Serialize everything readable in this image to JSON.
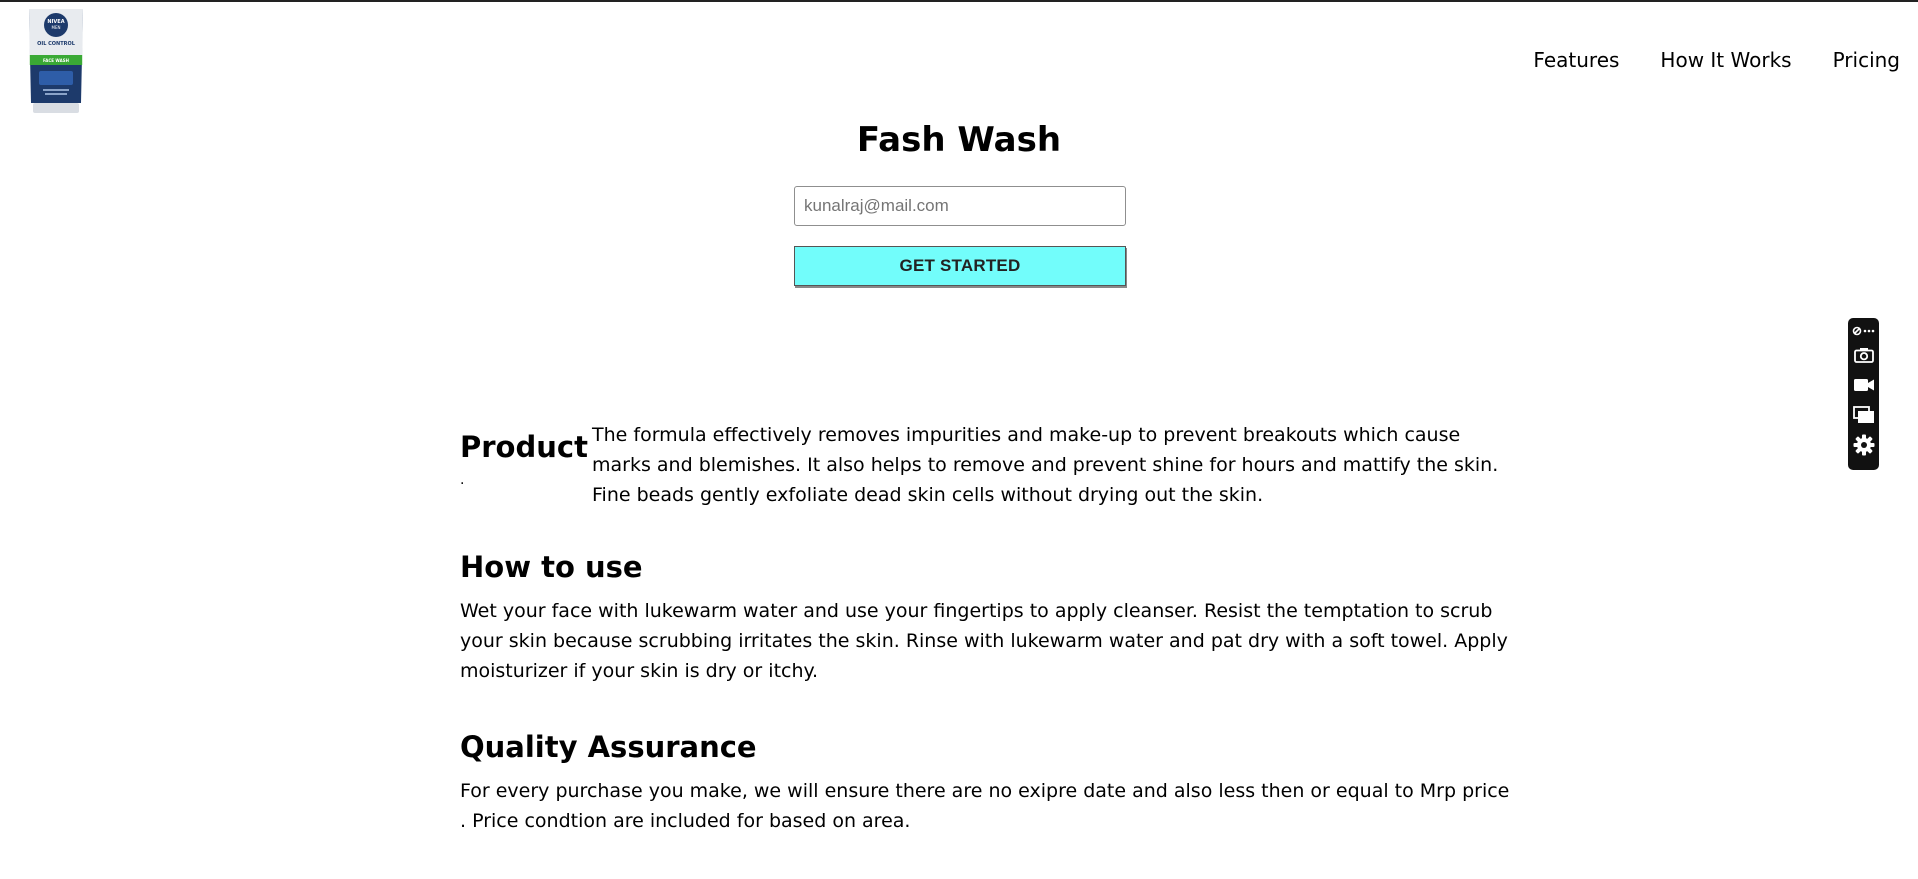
{
  "brand": {
    "logo_text": [
      "NIVEA",
      "MEN",
      "OIL CONTROL",
      "FACE WASH"
    ],
    "logo_colors": {
      "tube": "#1d3a6b",
      "band": "#3aa935",
      "cap": "#d9dde3"
    }
  },
  "nav": {
    "items": [
      {
        "label": "Features"
      },
      {
        "label": "How It Works"
      },
      {
        "label": "Pricing"
      }
    ]
  },
  "hero": {
    "title": "Fash Wash",
    "email_placeholder": "kunalraj@mail.com",
    "cta_label": "GET STARTED",
    "cta_color": "#72fdfb"
  },
  "product": {
    "heading": "Product",
    "dot": ".",
    "text": "The formula effectively removes impurities and make-up to prevent breakouts which cause marks and blemishes. It also helps to remove and prevent shine for hours and mattify the skin. Fine beads gently exfoliate dead skin cells without drying out the skin."
  },
  "how_to_use": {
    "heading": "How to use",
    "text": "Wet your face with lukewarm water and use your fingertips to apply cleanser. Resist the temptation to scrub your skin because scrubbing irritates the skin. Rinse with lukewarm water and pat dry with a soft towel. Apply moisturizer if your skin is dry or itchy."
  },
  "quality": {
    "heading": "Quality Assurance",
    "text": "For every purchase you make, we will ensure there are no exipre date and also less then or equal to Mrp price . Price condtion are included for based on area."
  },
  "toolbar": {
    "icons": [
      "link-more-icon",
      "camera-icon",
      "video-camera-icon",
      "windows-icon",
      "gear-icon"
    ]
  }
}
